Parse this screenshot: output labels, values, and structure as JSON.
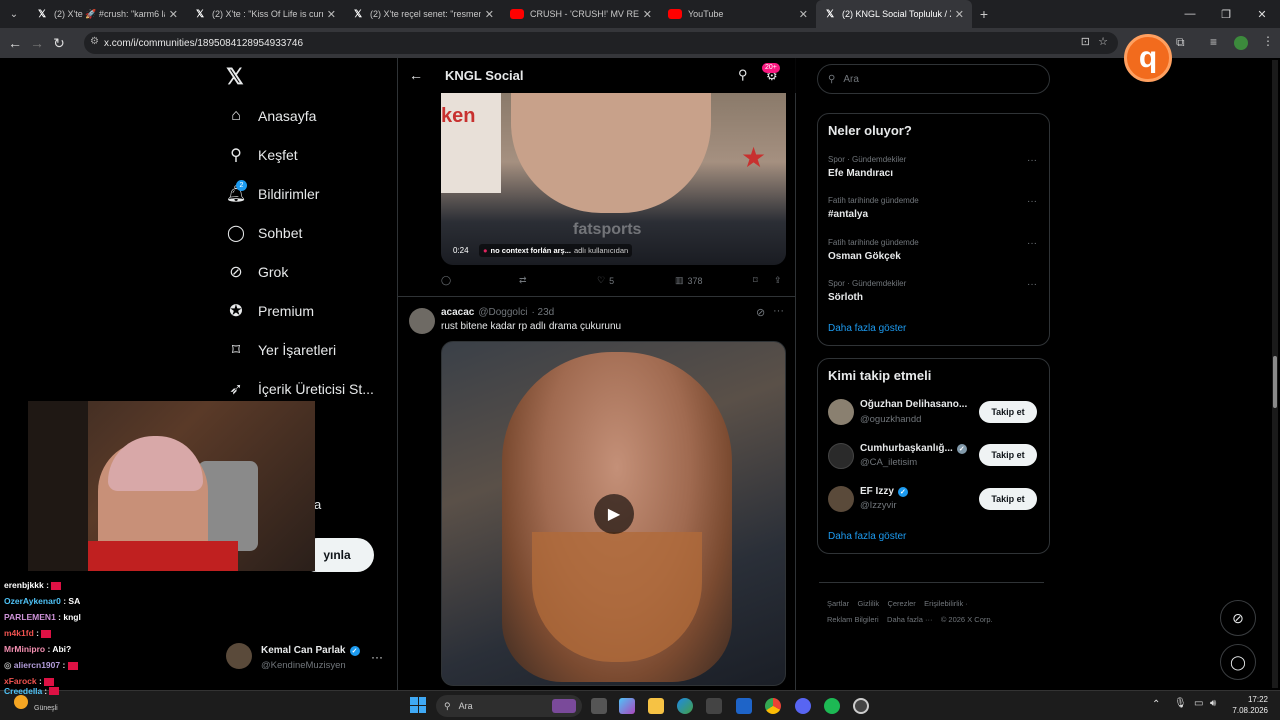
{
  "browser": {
    "tabs": [
      {
        "label": "(2) X'te 🚀 #crush: \"karm6 lans",
        "icon": "x-logo-icon"
      },
      {
        "label": "(2) X'te : \"Kiss Of Life is currently",
        "icon": "x-logo-icon"
      },
      {
        "label": "(2) X'te reçel senet: \"resmen ayı",
        "icon": "x-logo-icon"
      },
      {
        "label": "CRUSH - 'CRUSH!' MV REACTIO",
        "icon": "youtube-icon"
      },
      {
        "label": "YouTube",
        "icon": "youtube-icon"
      },
      {
        "label": "(2) KNGL Social Topluluk / X",
        "icon": "x-logo-icon"
      }
    ],
    "url": "x.com/i/communities/1895084128954933746"
  },
  "nav": {
    "items": [
      {
        "label": "Anasayfa",
        "icon": "home-icon"
      },
      {
        "label": "Keşfet",
        "icon": "search-icon"
      },
      {
        "label": "Bildirimler",
        "icon": "bell-icon",
        "badge": "2"
      },
      {
        "label": "Sohbet",
        "icon": "chat-icon"
      },
      {
        "label": "Grok",
        "icon": "grok-icon"
      },
      {
        "label": "Premium",
        "icon": "premium-icon"
      },
      {
        "label": "Yer İşaretleri",
        "icon": "bookmark-icon"
      },
      {
        "label": "İçerik Üreticisi St...",
        "icon": "rocket-icon"
      }
    ],
    "partial_label": "a",
    "post_button_partial": "yınla",
    "profile": {
      "name": "Kemal Can Parlak",
      "handle": "@KendineMuzisyen"
    }
  },
  "header": {
    "title": "KNGL Social",
    "badge": "20+"
  },
  "posts": [
    {
      "video_time": "0:24",
      "caption": "no context forlán arş...",
      "caption_suffix": "adlı kullanıcıdan",
      "watermark": "fatsports",
      "likes": "5",
      "views": "378"
    },
    {
      "author": "acacac",
      "handle": "@Doggolci",
      "time": "· 23d",
      "text": "rust bitene kadar rp adlı drama çukurunu"
    }
  ],
  "search": {
    "placeholder": "Ara"
  },
  "trends": {
    "title": "Neler oluyor?",
    "items": [
      {
        "category": "Spor · Gündemdekiler",
        "name": "Efe Mandıracı"
      },
      {
        "category": "Fatih tarihinde gündemde",
        "name": "#antalya"
      },
      {
        "category": "Fatih tarihinde gündemde",
        "name": "Osman Gökçek"
      },
      {
        "category": "Spor · Gündemdekiler",
        "name": "Sörloth"
      }
    ],
    "more": "Daha fazla göster"
  },
  "who_to_follow": {
    "title": "Kimi takip etmeli",
    "items": [
      {
        "name": "Oğuzhan Delihasano...",
        "handle": "@oguzkhandd",
        "button": "Takip et"
      },
      {
        "name": "Cumhurbaşkanlığ...",
        "handle": "@CA_iletisim",
        "button": "Takip et"
      },
      {
        "name": "EF Izzy",
        "handle": "@Izzyvir",
        "button": "Takip et"
      }
    ],
    "more": "Daha fazla göster"
  },
  "footer": {
    "links": [
      "Şartlar",
      "Gizlilik",
      "Çerezler",
      "Erişilebilirlik",
      "Reklam Bilgileri",
      "Daha fazla ···",
      "© 2026 X Corp."
    ]
  },
  "chat": [
    {
      "user": "erenbjkkk",
      "msg": "",
      "color": "#ffffff"
    },
    {
      "user": "OzerAykenar0",
      "msg": "SA",
      "color": "#4fc3f7"
    },
    {
      "user": "PARLEMEN1",
      "msg": "kngl",
      "color": "#ce93d8"
    },
    {
      "user": "m4k1fd",
      "msg": "",
      "color": "#ef5350"
    },
    {
      "user": "MrMinipro",
      "msg": "Abi?",
      "color": "#f48fb1"
    },
    {
      "user": "aliercn1907",
      "msg": "",
      "color": "#b39ddb"
    },
    {
      "user": "xFarock",
      "msg": "",
      "color": "#ef5350"
    },
    {
      "user": "Creedella",
      "msg": "",
      "color": "#4fc3f7"
    }
  ],
  "taskbar": {
    "search": "Ara",
    "weather": "Güneşli",
    "time": "17:22",
    "date": "7.08.2026"
  }
}
